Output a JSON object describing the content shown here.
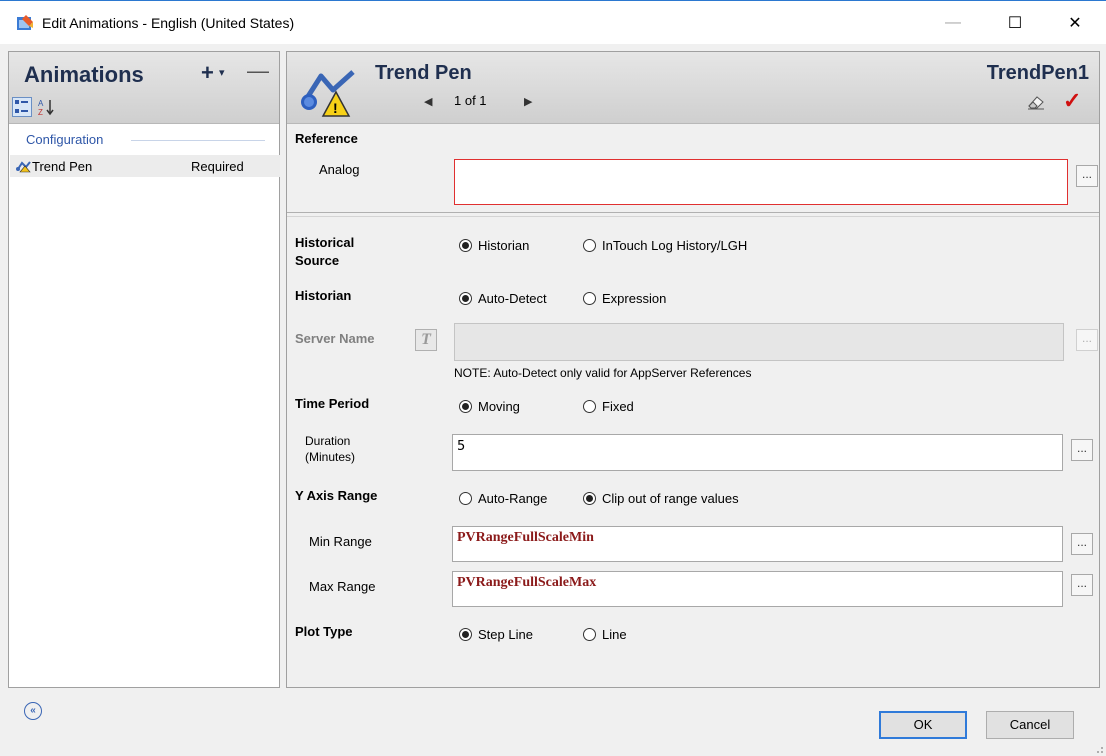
{
  "window": {
    "title": "Edit Animations - English (United States)",
    "minimize": "—",
    "maximize": "☐",
    "close": "✕"
  },
  "left": {
    "title": "Animations",
    "add": "+",
    "add_dropdown": "▾",
    "collapse": "—",
    "category_label": "Configuration",
    "items": [
      {
        "label": "Trend Pen",
        "status": "Required",
        "icon": "trend-pen-icon"
      }
    ]
  },
  "right": {
    "title": "Trend Pen",
    "name": "TrendPen1",
    "nav": {
      "text": "1 of 1",
      "prev": "◀",
      "next": "▶"
    },
    "check": "✓",
    "reference": {
      "heading": "Reference",
      "analog_label": "Analog",
      "analog_value": ""
    },
    "historical_source": {
      "label_line1": "Historical",
      "label_line2": "Source",
      "options": [
        "Historian",
        "InTouch Log History/LGH"
      ],
      "selected": "Historian"
    },
    "historian": {
      "label": "Historian",
      "options": [
        "Auto-Detect",
        "Expression"
      ],
      "selected": "Auto-Detect"
    },
    "server_name": {
      "label": "Server Name",
      "expr_glyph": "T",
      "value": "",
      "note": "NOTE: Auto-Detect only valid for AppServer References"
    },
    "time_period": {
      "label": "Time Period",
      "options": [
        "Moving",
        "Fixed"
      ],
      "selected": "Moving"
    },
    "duration": {
      "label_line1": "Duration",
      "label_line2": "(Minutes)",
      "value": "5"
    },
    "y_axis": {
      "label": "Y Axis Range",
      "options": [
        "Auto-Range",
        "Clip out of range values"
      ],
      "selected": "Clip out of range values"
    },
    "min_range": {
      "label": "Min Range",
      "value": "PVRangeFullScaleMin"
    },
    "max_range": {
      "label": "Max Range",
      "value": "PVRangeFullScaleMax"
    },
    "plot_type": {
      "label": "Plot Type",
      "options": [
        "Step Line",
        "Line"
      ],
      "selected": "Step Line"
    },
    "ellipsis": "..."
  },
  "footer": {
    "expand": "«",
    "ok": "OK",
    "cancel": "Cancel"
  },
  "colors": {
    "accent": "#2f7ad9",
    "invalid_border": "#e03030",
    "expression_text": "#8b1a1a",
    "header_text": "#1f2f4f"
  }
}
